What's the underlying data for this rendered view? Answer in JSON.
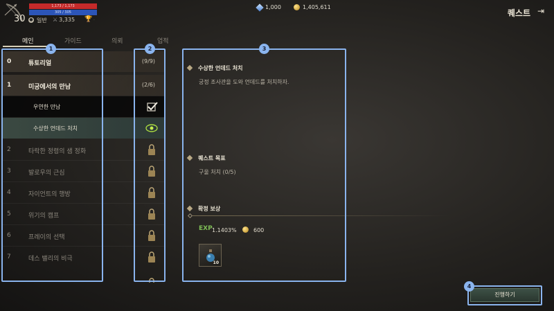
{
  "character": {
    "level": "30",
    "class": "일반",
    "hp": "1,173 / 1,173",
    "mp": "305 / 305",
    "power": "3,335"
  },
  "currency": {
    "gems": "1,000",
    "gold": "1,405,611"
  },
  "header": {
    "title": "퀘스트"
  },
  "tabs": [
    {
      "label": "메인",
      "active": true
    },
    {
      "label": "가이드"
    },
    {
      "label": "의뢰"
    },
    {
      "label": "업적"
    }
  ],
  "quests": [
    {
      "num": "0",
      "name": "튜토리얼",
      "count": "(9/9)",
      "type": "chapter"
    },
    {
      "num": "1",
      "name": "미궁에서의 만남",
      "count": "(2/6)",
      "type": "chapter"
    },
    {
      "num": "",
      "name": "우연한 만남",
      "count": "",
      "type": "sub-done",
      "icon": "check-icon"
    },
    {
      "num": "",
      "name": "수상한 언데드 처치",
      "count": "",
      "type": "sub-active",
      "icon": "eye-icon"
    },
    {
      "num": "2",
      "name": "타락한 정령의 샘 정화",
      "count": "",
      "type": "locked",
      "icon": "lock-icon"
    },
    {
      "num": "3",
      "name": "발로우의 근심",
      "count": "",
      "type": "locked",
      "icon": "lock-icon"
    },
    {
      "num": "4",
      "name": "자이언트의 행방",
      "count": "",
      "type": "locked",
      "icon": "lock-icon"
    },
    {
      "num": "5",
      "name": "위기의 캠프",
      "count": "",
      "type": "locked",
      "icon": "lock-icon"
    },
    {
      "num": "6",
      "name": "프레이의 선택",
      "count": "",
      "type": "locked",
      "icon": "lock-icon"
    },
    {
      "num": "7",
      "name": "데스 밸리의 비극",
      "count": "",
      "type": "locked",
      "icon": "lock-icon"
    }
  ],
  "detail": {
    "quest_title": "수상한 언데드 처치",
    "quest_desc": "궁정 조사관을 도와 언데드를 처치하자.",
    "goal_title": "퀘스트 목표",
    "goal_text": "구울 처치 (0/5)",
    "reward_title": "확정 보상",
    "exp": "1.1403%",
    "gold": "600",
    "item_count": "10"
  },
  "actions": {
    "proceed": "진행하기"
  },
  "annotations": [
    "1",
    "2",
    "3",
    "4"
  ],
  "colors": {
    "accent": "#8ab4ee",
    "hp": "#c42a2a",
    "mp": "#2c55b8"
  }
}
